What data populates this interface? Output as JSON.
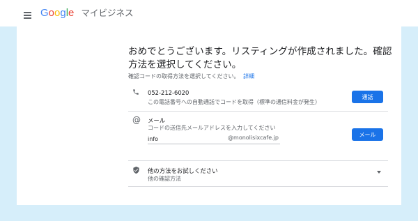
{
  "header": {
    "brand_logo": "Google",
    "product_name": "マイビジネス",
    "logo_colors": [
      "#4285F4",
      "#EA4335",
      "#FBBC05",
      "#4285F4",
      "#34A853",
      "#EA4335"
    ]
  },
  "main": {
    "title": "おめでとうございます。リスティングが作成されました。確認方法を選択してください。",
    "helper_text": "確認コードの取得方法を選択してください。",
    "details_link": "詳細"
  },
  "options": {
    "phone": {
      "icon": "phone-icon",
      "number": "052-212-6020",
      "description": "この電話番号への自動通話でコードを取得（標準の通信料金が発生）",
      "button_label": "通話"
    },
    "email": {
      "icon": "at-sign-icon",
      "title": "メール",
      "description": "コードの送信先メールアドレスを入力してください",
      "input_value": "info",
      "domain": "@monolisixcafe.jp",
      "button_label": "メール"
    },
    "other": {
      "icon": "shield-check-icon",
      "title": "他の方法をお試しください",
      "subtitle": "他の確認方法"
    }
  },
  "colors": {
    "accent": "#1a73e8",
    "background": "#d6eefa"
  }
}
